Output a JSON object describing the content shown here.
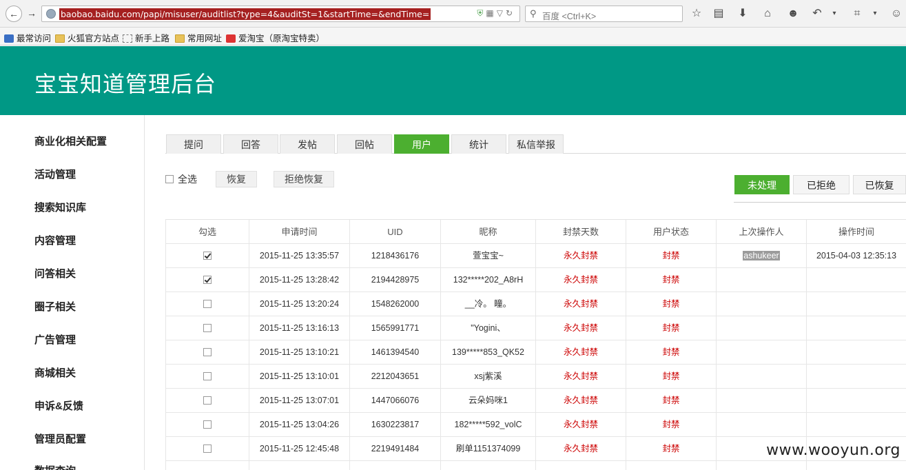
{
  "browser": {
    "url": "baobao.baidu.com/papi/misuser/auditlist?type=4&auditSt=1&startTime=&endTime=",
    "search_placeholder": "百度 <Ctrl+K>",
    "bookmarks": [
      "最常访问",
      "火狐官方站点",
      "新手上路",
      "常用网址",
      "爱淘宝（原淘宝特卖）"
    ]
  },
  "app": {
    "title": "宝宝知道管理后台",
    "accent": "#009885",
    "active": "#4caf30"
  },
  "sidebar": {
    "items": [
      "商业化相关配置",
      "活动管理",
      "搜索知识库",
      "内容管理",
      "问答相关",
      "圈子相关",
      "广告管理",
      "商城相关",
      "申诉&反馈",
      "管理员配置",
      "数据查询"
    ]
  },
  "tabs": [
    "提问",
    "回答",
    "发帖",
    "回帖",
    "用户",
    "统计",
    "私信举报"
  ],
  "active_tab": "用户",
  "actions": {
    "select_all": "全选",
    "restore": "恢复",
    "reject_restore": "拒绝恢复"
  },
  "status_tabs": [
    "未处理",
    "已拒绝",
    "已恢复"
  ],
  "active_status": "未处理",
  "table": {
    "headers": [
      "勾选",
      "申请时间",
      "UID",
      "昵称",
      "封禁天数",
      "用户状态",
      "上次操作人",
      "操作时间"
    ],
    "rows": [
      {
        "checked": true,
        "time": "2015-11-25 13:35:57",
        "uid": "1218436176",
        "nick": "萱宝宝~",
        "days": "永久封禁",
        "status": "封禁",
        "operator": "ashukeer",
        "op_time": "2015-04-03 12:35:13"
      },
      {
        "checked": true,
        "time": "2015-11-25 13:28:42",
        "uid": "2194428975",
        "nick": "132*****202_A8rH",
        "days": "永久封禁",
        "status": "封禁",
        "operator": "",
        "op_time": ""
      },
      {
        "checked": false,
        "time": "2015-11-25 13:20:24",
        "uid": "1548262000",
        "nick": "__冷。 瞳。",
        "days": "永久封禁",
        "status": "封禁",
        "operator": "",
        "op_time": ""
      },
      {
        "checked": false,
        "time": "2015-11-25 13:16:13",
        "uid": "1565991771",
        "nick": "\"Yogini、",
        "days": "永久封禁",
        "status": "封禁",
        "operator": "",
        "op_time": ""
      },
      {
        "checked": false,
        "time": "2015-11-25 13:10:21",
        "uid": "1461394540",
        "nick": "139*****853_QK52",
        "days": "永久封禁",
        "status": "封禁",
        "operator": "",
        "op_time": ""
      },
      {
        "checked": false,
        "time": "2015-11-25 13:10:01",
        "uid": "2212043651",
        "nick": "xsj紫溪",
        "days": "永久封禁",
        "status": "封禁",
        "operator": "",
        "op_time": ""
      },
      {
        "checked": false,
        "time": "2015-11-25 13:07:01",
        "uid": "1447066076",
        "nick": "云朵妈咪1",
        "days": "永久封禁",
        "status": "封禁",
        "operator": "",
        "op_time": ""
      },
      {
        "checked": false,
        "time": "2015-11-25 13:04:26",
        "uid": "1630223817",
        "nick": "182*****592_volC",
        "days": "永久封禁",
        "status": "封禁",
        "operator": "",
        "op_time": ""
      },
      {
        "checked": false,
        "time": "2015-11-25 12:45:48",
        "uid": "2219491484",
        "nick": "刷单1151374099",
        "days": "永久封禁",
        "status": "封禁",
        "operator": "",
        "op_time": ""
      }
    ]
  },
  "watermark": "www.wooyun.org"
}
